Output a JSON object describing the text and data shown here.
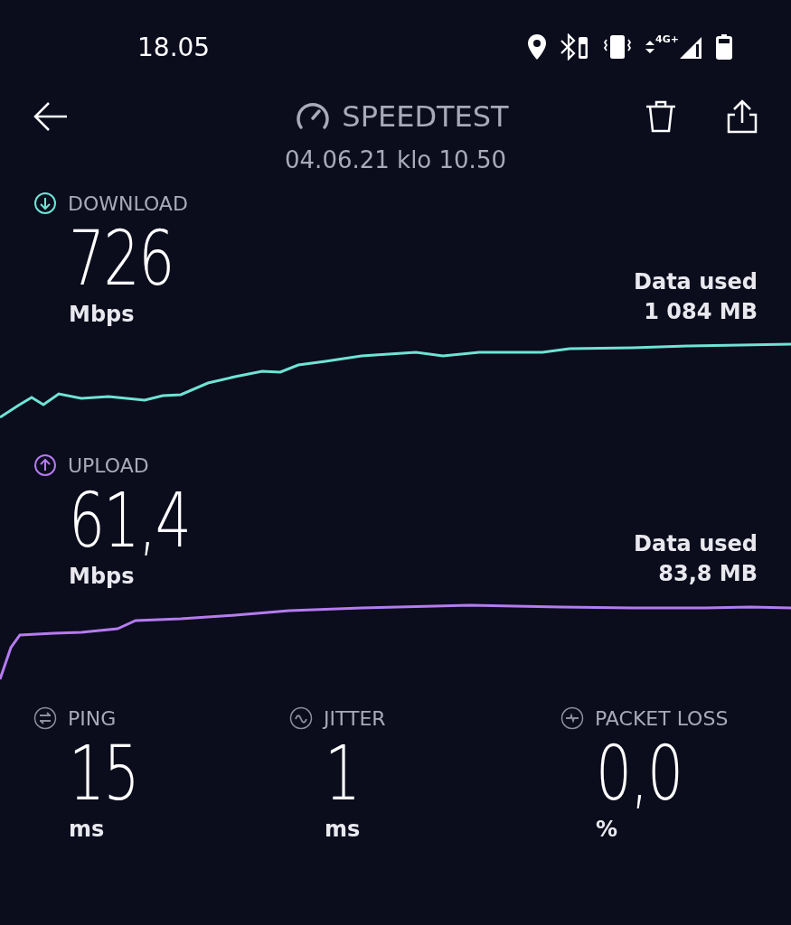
{
  "status_bar": {
    "time": "18.05",
    "network": "4G+"
  },
  "header": {
    "title": "SPEEDTEST",
    "date": "04.06.21 klo 10.50"
  },
  "speeds": [
    {
      "kind": "download",
      "label": "DOWNLOAD",
      "value": "726",
      "unit": "Mbps",
      "data_label": "Data used",
      "data_value": "1 084 MB",
      "color": "#6fe3d4"
    },
    {
      "kind": "upload",
      "label": "UPLOAD",
      "value": "61,4",
      "unit": "Mbps",
      "data_label": "Data used",
      "data_value": "83,8 MB",
      "color": "#b57bf0"
    }
  ],
  "stats": [
    {
      "kind": "ping",
      "label": "PING",
      "value": "15",
      "unit": "ms"
    },
    {
      "kind": "jitter",
      "label": "JITTER",
      "value": "1",
      "unit": "ms"
    },
    {
      "kind": "packet_loss",
      "label": "PACKET LOSS",
      "value": "0,0",
      "unit": "%"
    }
  ]
}
